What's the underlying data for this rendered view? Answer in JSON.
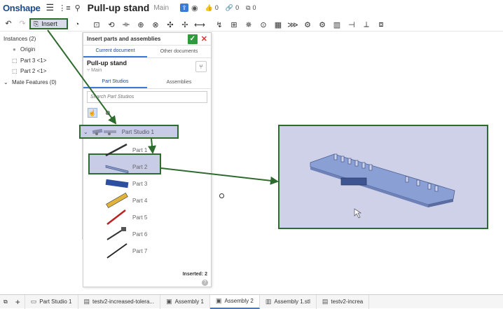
{
  "topbar": {
    "logo": "Onshape",
    "title": "Pull-up stand",
    "branch": "Main",
    "likes": "0",
    "links": "0",
    "copies": "0"
  },
  "toolbar": {
    "insert_label": "Insert"
  },
  "left_panel": {
    "instances_label": "Instances (2)",
    "items": [
      {
        "label": "Origin"
      },
      {
        "label": "Part 3 <1>"
      },
      {
        "label": "Part 2 <1>"
      }
    ],
    "mate_features": "Mate Features (0)"
  },
  "dialog": {
    "title": "Insert parts and assemblies",
    "tabs": [
      "Current document",
      "Other documents"
    ],
    "doc_name": "Pull-up stand",
    "doc_branch": "Main",
    "subtabs": [
      "Part Studios",
      "Assemblies"
    ],
    "search_placeholder": "Search Part Studios",
    "part_studio_label": "Part Studio 1",
    "parts": [
      {
        "label": "Part 1"
      },
      {
        "label": "Part 2"
      },
      {
        "label": "Part 3"
      },
      {
        "label": "Part 4"
      },
      {
        "label": "Part 5"
      },
      {
        "label": "Part 6"
      },
      {
        "label": "Part 7"
      }
    ],
    "inserted_label": "Inserted: 2"
  },
  "bottom_tabs": [
    {
      "label": "Part Studio 1",
      "icon": "part-studio-icon"
    },
    {
      "label": "testv2-increased-tolera...",
      "icon": "document-icon"
    },
    {
      "label": "Assembly 1",
      "icon": "assembly-icon"
    },
    {
      "label": "Assembly 2",
      "icon": "assembly-icon",
      "active": true
    },
    {
      "label": "Assembly 1.stl",
      "icon": "stl-icon"
    },
    {
      "label": "testv2-increa",
      "icon": "document-icon"
    }
  ],
  "colors": {
    "accent": "#3b7ad8",
    "highlight_border": "#2e6b2e",
    "highlight_fill": "#c8cce6",
    "ok_green": "#2d9c3c",
    "brand": "#1a4a8c"
  }
}
